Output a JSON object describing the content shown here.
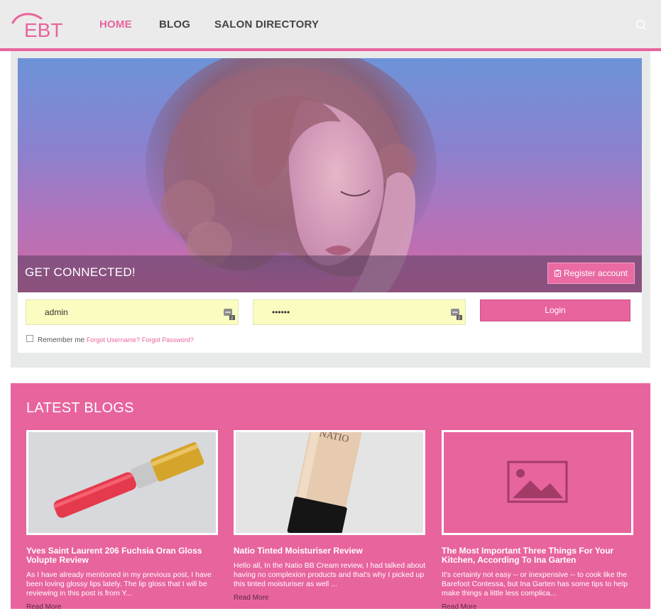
{
  "header": {
    "logo_text": "EBT",
    "nav": [
      {
        "label": "HOME",
        "active": true
      },
      {
        "label": "BLOG",
        "active": false
      },
      {
        "label": "SALON DIRECTORY",
        "active": false
      }
    ],
    "search_icon": "search-icon"
  },
  "hero": {
    "title": "GET CONNECTED!",
    "register_label": "Register account",
    "register_icon": "clipboard-check-icon"
  },
  "login": {
    "username_value": "admin",
    "password_value": "••••••",
    "login_label": "Login",
    "remember_label": "Remember me",
    "forgot_username": "Forgot Username?",
    "forgot_password": "Forgot Password?"
  },
  "blogs": {
    "title": "LATEST BLOGS",
    "items": [
      {
        "title": "Yves Saint Laurent 206 Fuchsia Oran Gloss Volupte Review",
        "excerpt": "As I have already mentioned in my previous post, I have been loving glossy lips lately. The lip gloss that I will be reviewing in this post is from Y...",
        "more": "Read More",
        "image": "lip-gloss-photo"
      },
      {
        "title": "Natio Tinted Moisturiser Review",
        "excerpt": "Hello all, In the Natio BB Cream review, I had talked about having no complexion products and that's why I picked up this tinted moisturiser as well ...",
        "more": "Read More",
        "image": "moisturiser-photo"
      },
      {
        "title": "The Most Important Three Things For Your Kitchen, According To Ina Garten",
        "excerpt": "It's certainly not easy -- or inexpensive -- to cook like the Barefoot Contessa, but Ina Garten has some tips to help make things a little less complica...",
        "more": "Read More",
        "image": "image-placeholder-icon"
      }
    ]
  },
  "colors": {
    "accent": "#e8649d",
    "header_bg": "#ebebeb",
    "field_bg": "#fbfdc0"
  }
}
